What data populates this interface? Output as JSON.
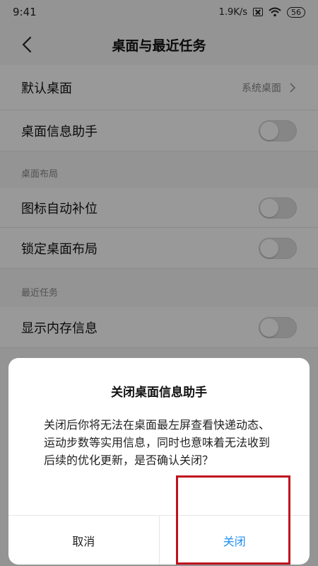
{
  "status_bar": {
    "time": "9:41",
    "network_speed": "1.9K/s",
    "battery": "56"
  },
  "header": {
    "title": "桌面与最近任务"
  },
  "settings": {
    "default_launcher": {
      "label": "默认桌面",
      "value": "系统桌面"
    },
    "desktop_assistant": {
      "label": "桌面信息助手",
      "enabled": false
    },
    "layout_section": "桌面布局",
    "auto_fill_icons": {
      "label": "图标自动补位",
      "enabled": false
    },
    "lock_layout": {
      "label": "锁定桌面布局",
      "enabled": false
    },
    "recent_section": "最近任务",
    "show_memory": {
      "label": "显示内存信息",
      "enabled": false
    }
  },
  "dialog": {
    "title": "关闭桌面信息助手",
    "message": "关闭后你将无法在桌面最左屏查看快递动态、运动步数等实用信息，同时也意味着无法收到后续的优化更新，是否确认关闭？",
    "cancel_label": "取消",
    "confirm_label": "关闭"
  },
  "colors": {
    "accent": "#1f8ff2",
    "highlight": "#c0111f"
  }
}
